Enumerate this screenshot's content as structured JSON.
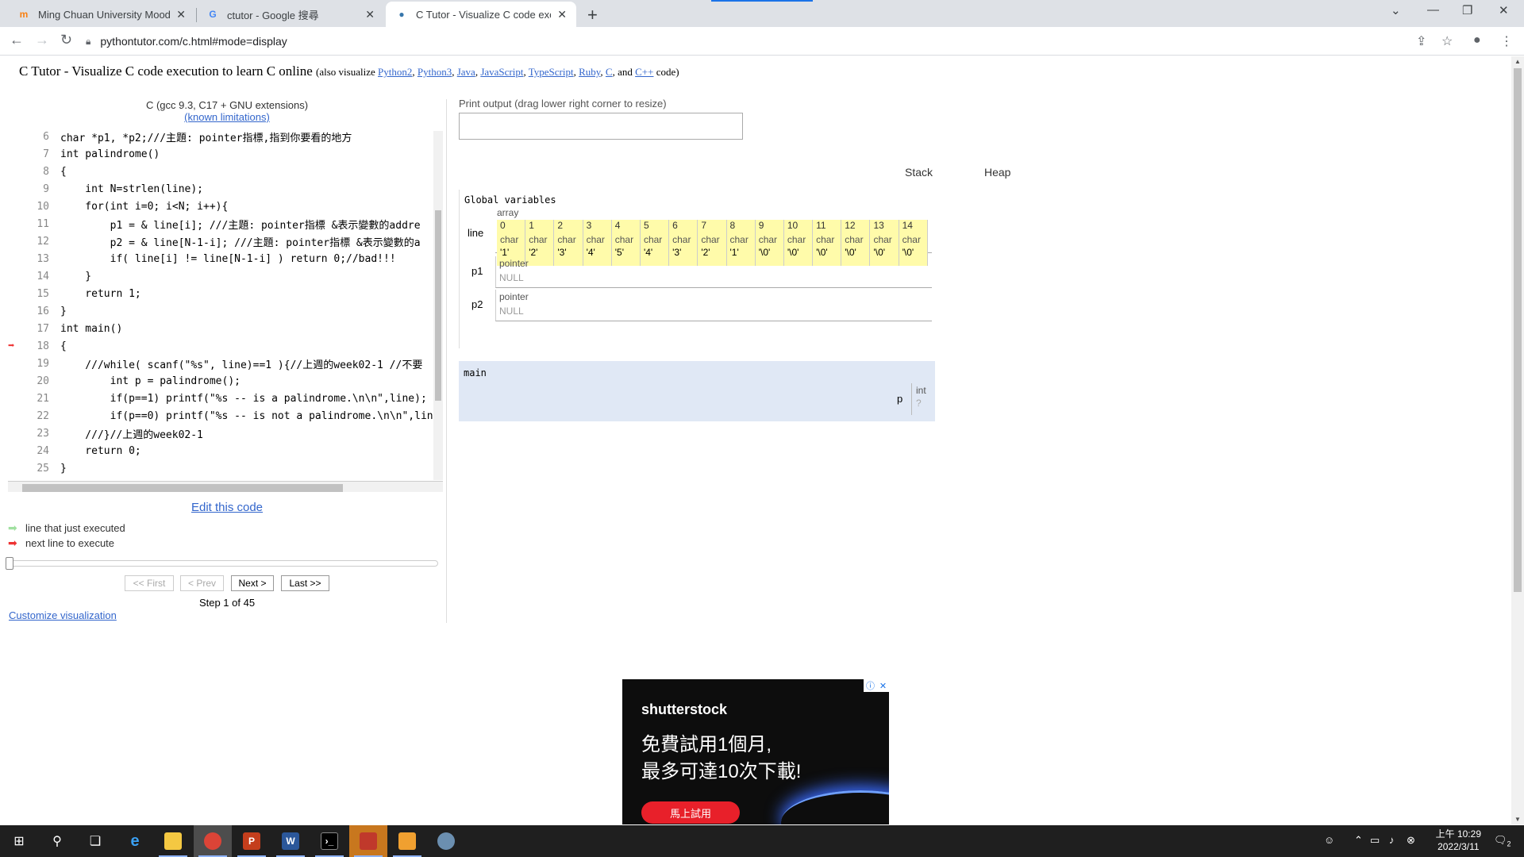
{
  "browser": {
    "tabs": [
      {
        "title": "Ming Chuan University Moodle",
        "favicon": "moodle-icon"
      },
      {
        "title": "ctutor - Google 搜尋",
        "favicon": "google-icon"
      },
      {
        "title": "C Tutor - Visualize C code execu",
        "favicon": "python-icon"
      }
    ],
    "url": "pythontutor.com/c.html#mode=display"
  },
  "page": {
    "title_main": "C Tutor - Visualize C code execution to learn C online",
    "title_also": "(also visualize",
    "title_links": [
      "Python2",
      "Python3",
      "Java",
      "JavaScript",
      "TypeScript",
      "Ruby",
      "C",
      "C++"
    ],
    "title_and": "and",
    "title_end": "code)",
    "compiler": "C (gcc 9.3, C17 + GNU extensions)",
    "known_limitations": "(known limitations)"
  },
  "code": {
    "current_line": 18,
    "lines": [
      {
        "n": "6",
        "src": "char *p1, *p2;///主題: pointer指標,指到你要看的地方"
      },
      {
        "n": "7",
        "src": "int palindrome()"
      },
      {
        "n": "8",
        "src": "{"
      },
      {
        "n": "9",
        "src": "    int N=strlen(line);"
      },
      {
        "n": "10",
        "src": "    for(int i=0; i<N; i++){"
      },
      {
        "n": "11",
        "src": "        p1 = & line[i]; ///主題: pointer指標 &表示變數的addre"
      },
      {
        "n": "12",
        "src": "        p2 = & line[N-1-i]; ///主題: pointer指標 &表示變數的a"
      },
      {
        "n": "13",
        "src": "        if( line[i] != line[N-1-i] ) return 0;//bad!!!"
      },
      {
        "n": "14",
        "src": "    }"
      },
      {
        "n": "15",
        "src": "    return 1;"
      },
      {
        "n": "16",
        "src": "}"
      },
      {
        "n": "17",
        "src": "int main()"
      },
      {
        "n": "18",
        "src": "{"
      },
      {
        "n": "19",
        "src": "    ///while( scanf(\"%s\", line)==1 ){//上週的week02-1 //不要"
      },
      {
        "n": "20",
        "src": "        int p = palindrome();"
      },
      {
        "n": "21",
        "src": "        if(p==1) printf(\"%s -- is a palindrome.\\n\\n\",line);"
      },
      {
        "n": "22",
        "src": "        if(p==0) printf(\"%s -- is not a palindrome.\\n\\n\",lin"
      },
      {
        "n": "23",
        "src": "    ///}//上週的week02-1"
      },
      {
        "n": "24",
        "src": "    return 0;"
      },
      {
        "n": "25",
        "src": "}"
      }
    ]
  },
  "controls": {
    "edit": "Edit this code",
    "legend_executed": "line that just executed",
    "legend_next": "next line to execute",
    "first": "<< First",
    "prev": "< Prev",
    "next": "Next >",
    "last": "Last >>",
    "step": "Step 1 of 45",
    "customize": "Customize visualization"
  },
  "viz": {
    "print_label": "Print output (drag lower right corner to resize)",
    "stack": "Stack",
    "heap": "Heap",
    "globals_title": "Global variables",
    "array_label": "array",
    "line_var": "line",
    "line_cells": [
      {
        "i": "0",
        "t": "char",
        "v": "'1'"
      },
      {
        "i": "1",
        "t": "char",
        "v": "'2'"
      },
      {
        "i": "2",
        "t": "char",
        "v": "'3'"
      },
      {
        "i": "3",
        "t": "char",
        "v": "'4'"
      },
      {
        "i": "4",
        "t": "char",
        "v": "'5'"
      },
      {
        "i": "5",
        "t": "char",
        "v": "'4'"
      },
      {
        "i": "6",
        "t": "char",
        "v": "'3'"
      },
      {
        "i": "7",
        "t": "char",
        "v": "'2'"
      },
      {
        "i": "8",
        "t": "char",
        "v": "'1'"
      },
      {
        "i": "9",
        "t": "char",
        "v": "'\\0'"
      },
      {
        "i": "10",
        "t": "char",
        "v": "'\\0'"
      },
      {
        "i": "11",
        "t": "char",
        "v": "'\\0'"
      },
      {
        "i": "12",
        "t": "char",
        "v": "'\\0'"
      },
      {
        "i": "13",
        "t": "char",
        "v": "'\\0'"
      },
      {
        "i": "14",
        "t": "char",
        "v": "'\\0'"
      }
    ],
    "p1": {
      "name": "p1",
      "type": "pointer",
      "value": "NULL"
    },
    "p2": {
      "name": "p2",
      "type": "pointer",
      "value": "NULL"
    },
    "main_title": "main",
    "main_var": {
      "name": "p",
      "type": "int",
      "value": "?"
    }
  },
  "ad": {
    "brand": "shutterstock",
    "line1": "免費試用1個月,",
    "line2": "最多可達10次下載!",
    "cta": "馬上試用"
  },
  "taskbar": {
    "time": "上午 10:29",
    "date": "2022/3/11",
    "notification_count": "2"
  },
  "colors": {
    "link": "#3366cc",
    "array_cell": "#fffbaa",
    "frame_bg": "#e0e8f5",
    "arrow_next": "#ee3333",
    "arrow_executed": "#a0e0a0"
  }
}
